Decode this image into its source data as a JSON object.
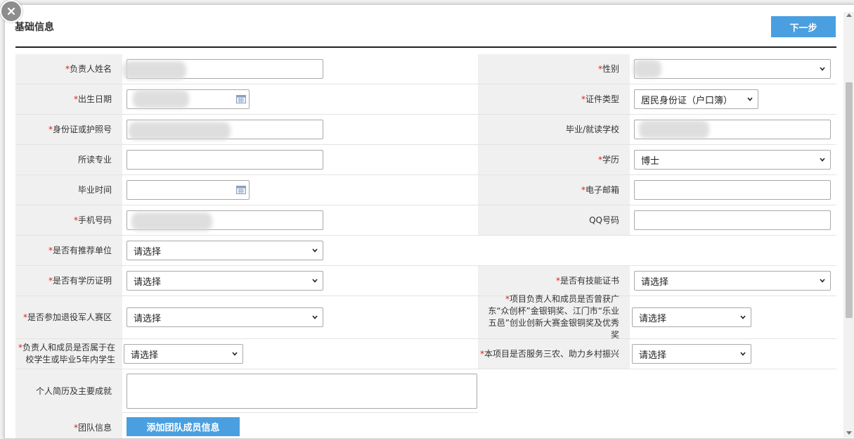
{
  "header": {
    "title": "基础信息",
    "next_label": "下一步"
  },
  "required_mark": "*",
  "fields": {
    "leader_name": {
      "label": "负责人姓名",
      "value": ""
    },
    "gender": {
      "label": "性别",
      "value": ""
    },
    "birth_date": {
      "label": "出生日期",
      "value": ""
    },
    "id_type": {
      "label": "证件类型",
      "value": "居民身份证（户口簿）"
    },
    "id_number": {
      "label": "身份证或护照号",
      "value": ""
    },
    "school": {
      "label": "毕业/就读学校",
      "value": ""
    },
    "major": {
      "label": "所读专业",
      "value": ""
    },
    "education": {
      "label": "学历",
      "value": "博士"
    },
    "grad_time": {
      "label": "毕业时间",
      "value": ""
    },
    "email": {
      "label": "电子邮箱",
      "value": ""
    },
    "phone": {
      "label": "手机号码",
      "value": ""
    },
    "qq": {
      "label": "QQ号码",
      "value": ""
    },
    "recommend_unit": {
      "label": "是否有推荐单位",
      "value": "请选择"
    },
    "degree_cert": {
      "label": "是否有学历证明",
      "value": "请选择"
    },
    "skill_cert": {
      "label": "是否有技能证书",
      "value": "请选择"
    },
    "veteran": {
      "label": "是否参加退役军人赛区",
      "value": "请选择"
    },
    "award": {
      "label": "项目负责人和成员是否曾获广东“众创杯”金银铜奖、江门市“乐业五邑”创业创新大赛金银铜奖及优秀奖",
      "value": "请选择"
    },
    "student": {
      "label": "负责人和成员是否属于在校学生或毕业5年内学生",
      "value": "请选择"
    },
    "rural": {
      "label": "本项目是否服务三农、助力乡村振兴",
      "value": "请选择"
    },
    "resume": {
      "label": "个人简历及主要成就",
      "value": ""
    },
    "team": {
      "label": "团队信息",
      "button": "添加团队成员信息"
    }
  },
  "icons": {
    "close": "close-icon",
    "calendar": "calendar-icon",
    "chevron": "chevron-down-icon"
  }
}
